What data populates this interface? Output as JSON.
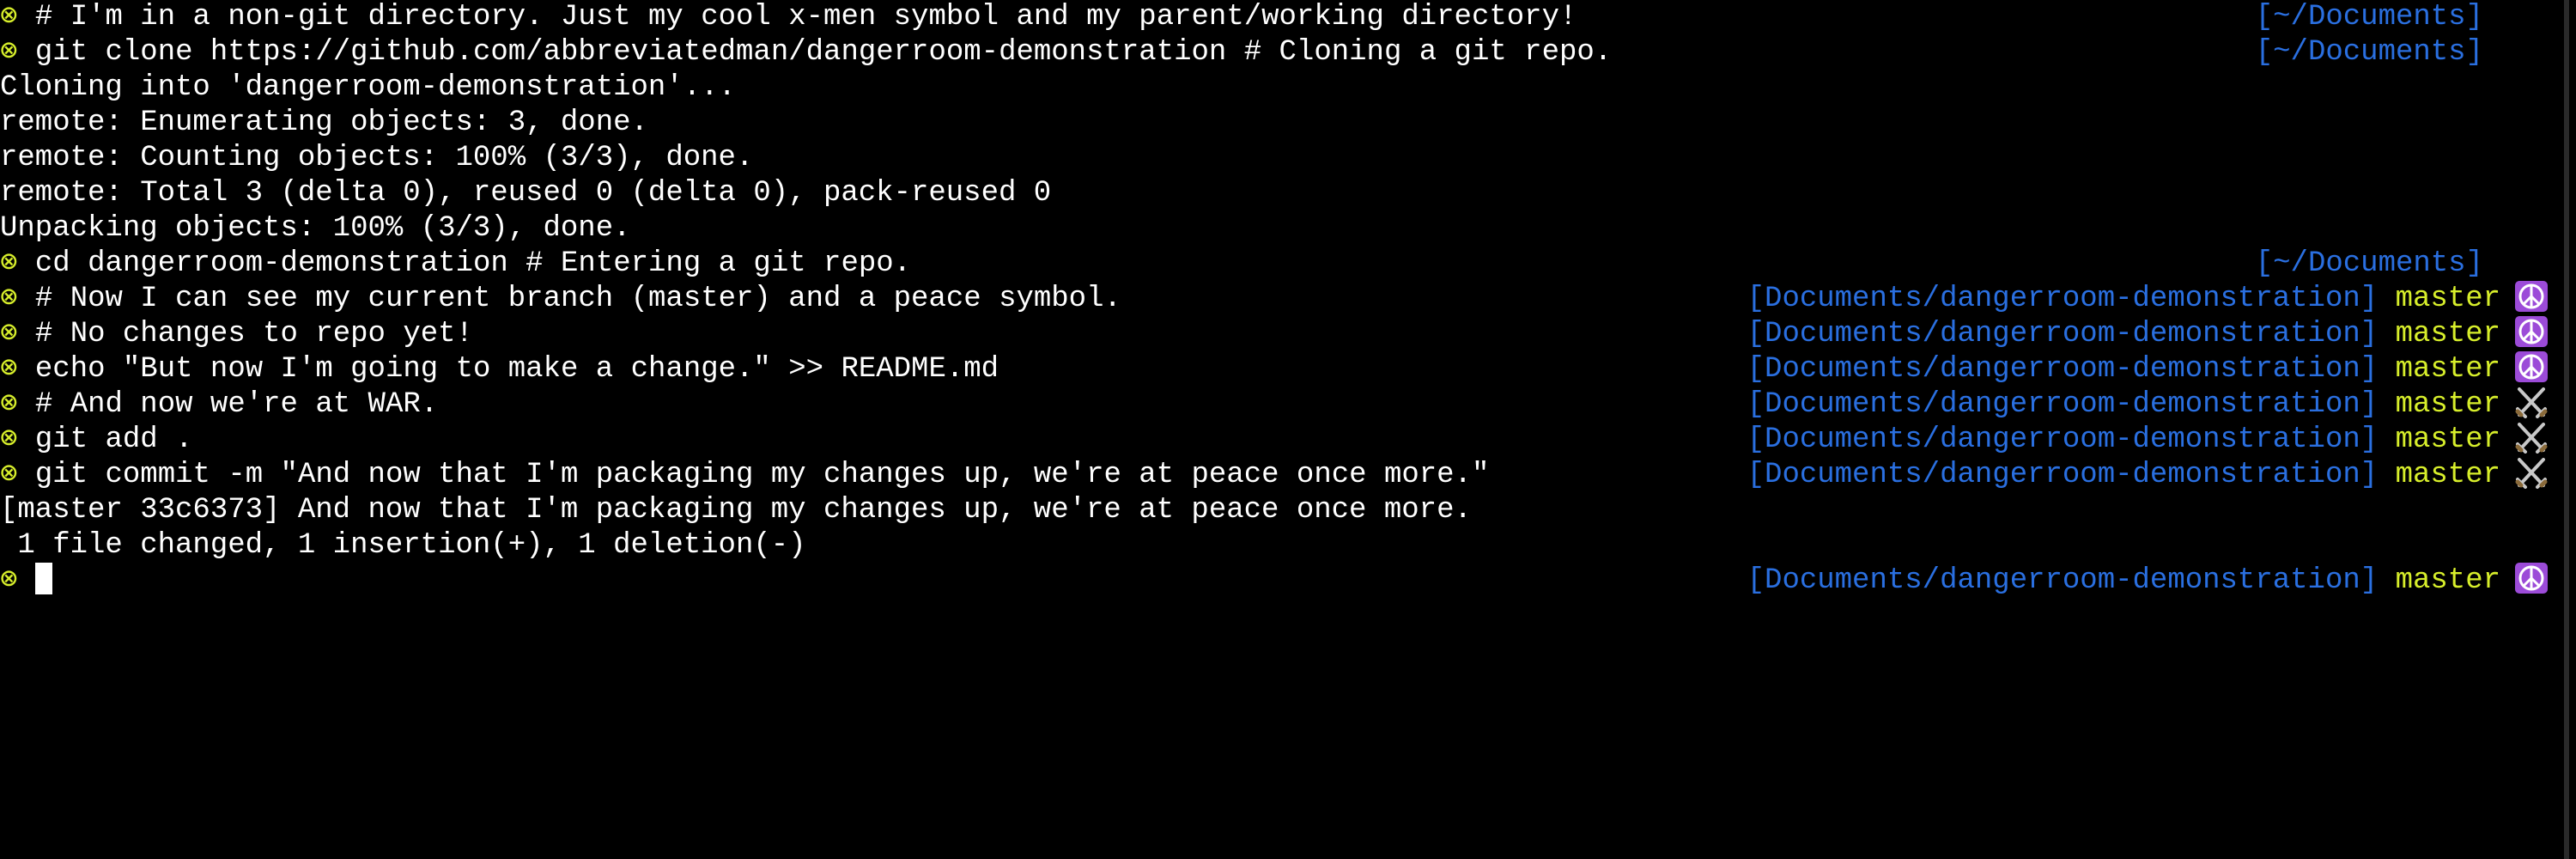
{
  "colors": {
    "background": "#000000",
    "text": "#ffffff",
    "prompt_mark": "#d7ee2b",
    "directory": "#2a6fe0",
    "branch": "#d7ee2b",
    "peace_bg": "#9c4bd8",
    "war_icon": "#c8c8c8"
  },
  "prompt_symbol": "⊗",
  "lines": [
    {
      "kind": "prompt",
      "text": "# I'm in a non-git directory. Just my cool x-men symbol and my parent/working directory!",
      "dir": "[~/Documents]"
    },
    {
      "kind": "prompt",
      "text": "git clone https://github.com/abbreviatedman/dangerroom-demonstration # Cloning a git repo.",
      "dir": "[~/Documents]"
    },
    {
      "kind": "output",
      "text": "Cloning into 'dangerroom-demonstration'..."
    },
    {
      "kind": "output",
      "text": "remote: Enumerating objects: 3, done."
    },
    {
      "kind": "output",
      "text": "remote: Counting objects: 100% (3/3), done."
    },
    {
      "kind": "output",
      "text": "remote: Total 3 (delta 0), reused 0 (delta 0), pack-reused 0"
    },
    {
      "kind": "output",
      "text": "Unpacking objects: 100% (3/3), done."
    },
    {
      "kind": "prompt",
      "text": "cd dangerroom-demonstration # Entering a git repo.",
      "dir": "[~/Documents]"
    },
    {
      "kind": "prompt",
      "text": "# Now I can see my current branch (master) and a peace symbol.",
      "dir": "[Documents/dangerroom-demonstration]",
      "branch": "master",
      "status": "peace-icon"
    },
    {
      "kind": "prompt",
      "text": "# No changes to repo yet!",
      "dir": "[Documents/dangerroom-demonstration]",
      "branch": "master",
      "status": "peace-icon"
    },
    {
      "kind": "prompt",
      "text": "echo \"But now I'm going to make a change.\" >> README.md",
      "dir": "[Documents/dangerroom-demonstration]",
      "branch": "master",
      "status": "peace-icon"
    },
    {
      "kind": "prompt",
      "text": "# And now we're at WAR.",
      "dir": "[Documents/dangerroom-demonstration]",
      "branch": "master",
      "status": "crossed-swords-icon"
    },
    {
      "kind": "prompt",
      "text": "git add .",
      "dir": "[Documents/dangerroom-demonstration]",
      "branch": "master",
      "status": "crossed-swords-icon"
    },
    {
      "kind": "prompt",
      "text": "git commit -m \"And now that I'm packaging my changes up, we're at peace once more.\"",
      "dir": "[Documents/dangerroom-demonstration]",
      "branch": "master",
      "status": "crossed-swords-icon"
    },
    {
      "kind": "output",
      "text": "[master 33c6373] And now that I'm packaging my changes up, we're at peace once more."
    },
    {
      "kind": "output",
      "text": " 1 file changed, 1 insertion(+), 1 deletion(-)"
    },
    {
      "kind": "current",
      "text": "",
      "dir": "[Documents/dangerroom-demonstration]",
      "branch": "master",
      "status": "peace-icon"
    }
  ]
}
